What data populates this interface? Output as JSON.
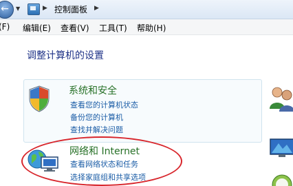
{
  "address_bar": {
    "breadcrumb": "控制面板"
  },
  "menubar": {
    "file": "(F)",
    "edit": "编辑(E)",
    "view": "查看(V)",
    "tools": "工具(T)",
    "help": "帮助(H)"
  },
  "main": {
    "heading": "调整计算机的设置",
    "categories": [
      {
        "title": "系统和安全",
        "icon": "shield-icon",
        "links": [
          "查看您的计算机状态",
          "备份您的计算机",
          "查找并解决问题"
        ]
      },
      {
        "title": "网络和 Internet",
        "icon": "network-globe-icon",
        "links": [
          "查看网络状态和任务",
          "选择家庭组和共享选项"
        ]
      }
    ]
  },
  "colors": {
    "heading": "#1e3287",
    "category_title": "#267026",
    "link": "#1a5ca6",
    "highlight": "#d8262c"
  }
}
